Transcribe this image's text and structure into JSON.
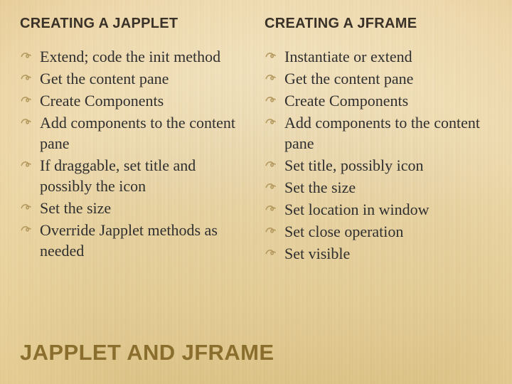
{
  "left": {
    "title": "CREATING A JAPPLET",
    "items": [
      "Extend; code the init method",
      "Get the content pane",
      "Create Components",
      "Add components to the content pane",
      "If draggable, set title and possibly the icon",
      "Set the size",
      "Override Japplet methods as needed"
    ]
  },
  "right": {
    "title": "CREATING A JFRAME",
    "items": [
      "Instantiate or extend",
      "Get the content pane",
      "Create Components",
      "Add components to the content pane",
      "Set title, possibly icon",
      "Set the size",
      "Set location in window",
      "Set close operation",
      "Set visible"
    ]
  },
  "footer": "JAPPLET AND JFRAME"
}
